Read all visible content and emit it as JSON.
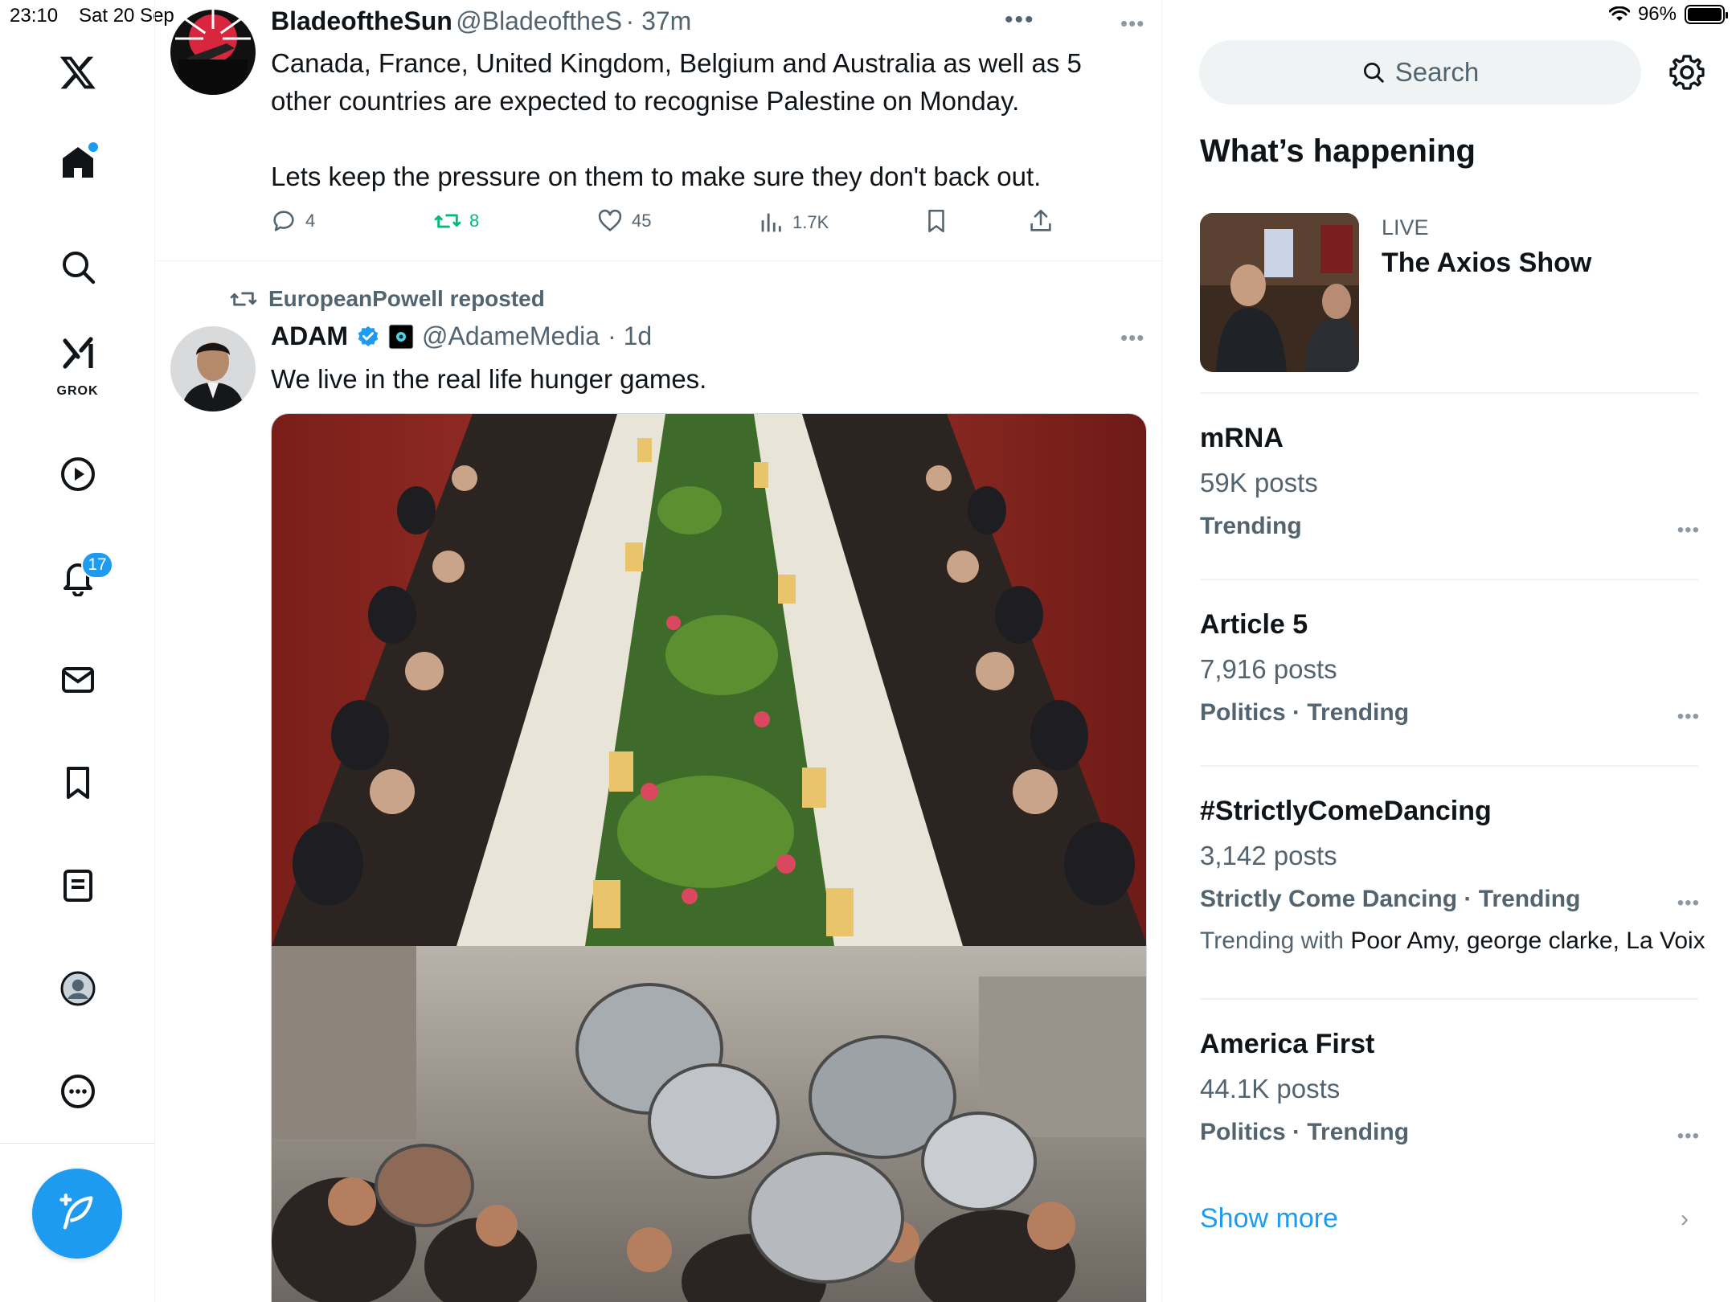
{
  "status_bar": {
    "time": "23:10",
    "date": "Sat 20 Sep",
    "battery": "96%"
  },
  "nav": {
    "grok_label": "GROK",
    "notifications_badge": "17"
  },
  "feed": {
    "top_dots": "•••",
    "tweet1": {
      "name": "BladeoftheSun",
      "handle": "@BladeoftheS",
      "time": "· 37m",
      "text": "Canada, France, United Kingdom, Belgium and Australia as well as 5\nother countries are expected to recognise Palestine on Monday.\n\nLets keep the pressure on them to make sure they don't back out.",
      "replies": "4",
      "reposts": "8",
      "likes": "45",
      "views": "1.7K",
      "more": "•••"
    },
    "tweet2": {
      "reposted_by": "EuropeanPowell reposted",
      "name": "ADAM",
      "handle": "@AdameMedia",
      "time": "· 1d",
      "text": "We live in the real life hunger games.",
      "more": "•••"
    }
  },
  "sidebar": {
    "search_placeholder": "Search",
    "whats_happening": "What’s happening",
    "live": {
      "label": "LIVE",
      "title": "The Axios Show"
    },
    "trends": [
      {
        "name": "mRNA",
        "posts": "59K posts",
        "meta": "Trending"
      },
      {
        "name": "Article 5",
        "posts": "7,916 posts",
        "meta": "Politics · Trending"
      },
      {
        "name": "#StrictlyComeDancing",
        "posts": "3,142 posts",
        "meta": "Strictly Come Dancing · Trending",
        "with_label": "Trending with",
        "with_names": "Poor Amy, george clarke, La Voix"
      },
      {
        "name": "America First",
        "posts": "44.1K posts",
        "meta": "Politics · Trending"
      }
    ],
    "trend_dots": "•••",
    "show_more": "Show more",
    "chevron": "›"
  },
  "colors": {
    "accent": "#1d9bf0",
    "repost_green": "#00ba7c",
    "muted": "#536471"
  }
}
